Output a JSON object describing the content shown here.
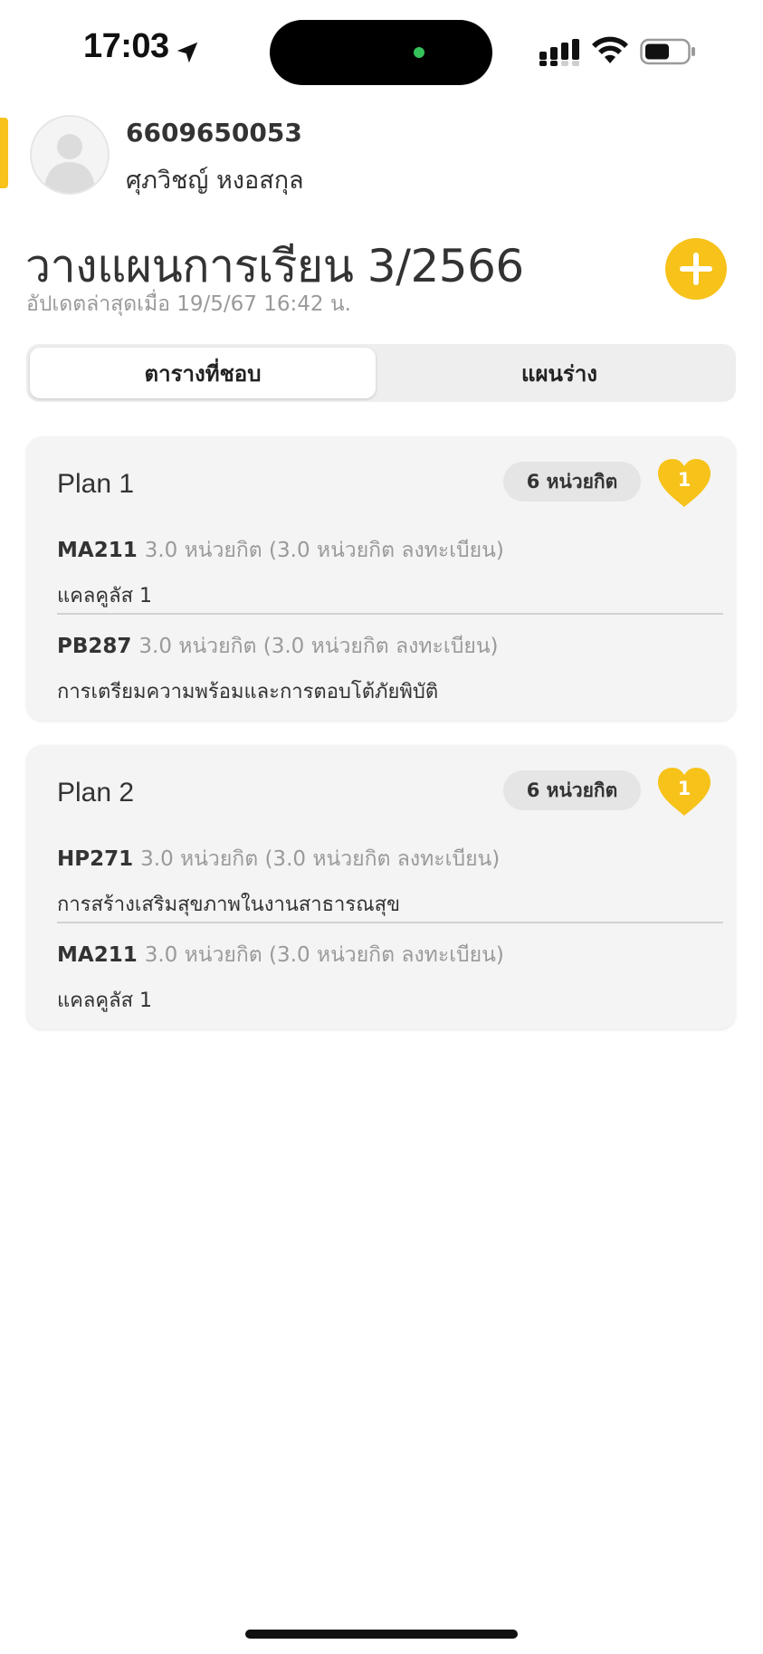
{
  "status_bar": {
    "time": "17:03",
    "icons": [
      "location-arrow-icon",
      "cellular-signal-icon",
      "wifi-icon",
      "battery-icon"
    ]
  },
  "profile": {
    "student_id": "6609650053",
    "name": "ศุภวิชญ์ หงอสกุล",
    "avatar_icon": "default-avatar-icon"
  },
  "header": {
    "title": "วางแผนการเรียน 3/2566",
    "updated": "อัปเดตล่าสุดเมื่อ 19/5/67 16:42 น.",
    "add_icon": "plus-icon"
  },
  "tabs": [
    {
      "label": "ตารางที่ชอบ",
      "selected": true
    },
    {
      "label": "แผนร่าง",
      "selected": false
    }
  ],
  "plans": [
    {
      "title": "Plan 1",
      "credits": "6 หน่วยกิต",
      "likes": "1",
      "courses": [
        {
          "code": "MA211",
          "credit": "3.0 หน่วยกิต (3.0 หน่วยกิต ลงทะเบียน)",
          "name": "แคลคูลัส 1"
        },
        {
          "code": "PB287",
          "credit": "3.0 หน่วยกิต (3.0 หน่วยกิต ลงทะเบียน)",
          "name": "การเตรียมความพร้อมและการตอบโต้ภัยพิบัติ"
        }
      ]
    },
    {
      "title": "Plan 2",
      "credits": "6 หน่วยกิต",
      "likes": "1",
      "courses": [
        {
          "code": "HP271",
          "credit": "3.0 หน่วยกิต (3.0 หน่วยกิต ลงทะเบียน)",
          "name": "การสร้างเสริมสุขภาพในงานสาธารณสุข"
        },
        {
          "code": "MA211",
          "credit": "3.0 หน่วยกิต (3.0 หน่วยกิต ลงทะเบียน)",
          "name": "แคลคูลัส 1"
        }
      ]
    }
  ],
  "colors": {
    "accent": "#f7c21a",
    "card_bg": "#f4f4f4",
    "muted_text": "#9a9a9a",
    "primary_text": "#333333"
  }
}
